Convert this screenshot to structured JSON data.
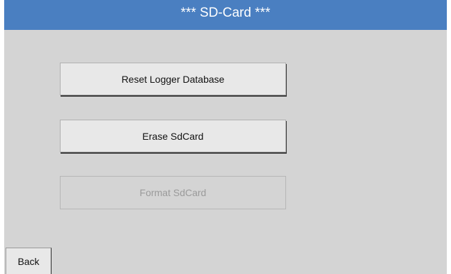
{
  "header": {
    "title": "***  SD-Card  ***"
  },
  "actions": {
    "reset_logger_database": "Reset Logger Database",
    "erase_sdcard": "Erase SdCard",
    "format_sdcard": "Format SdCard"
  },
  "footer": {
    "back_label": "Back"
  },
  "colors": {
    "title_bar": "#4a7fc1",
    "background": "#d4d4d4",
    "button_face": "#e8e8e8",
    "disabled_text": "#9a9a9a"
  }
}
